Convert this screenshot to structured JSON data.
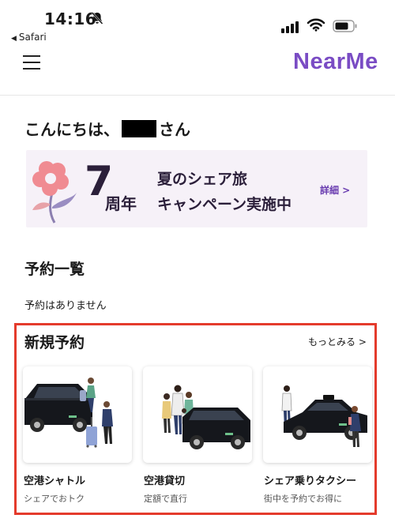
{
  "status_bar": {
    "time": "14:16",
    "back_app": "Safari"
  },
  "app_bar": {
    "logo": "NearMe"
  },
  "greeting": {
    "prefix": "こんにちは、",
    "suffix": "さん"
  },
  "banner": {
    "number": "7",
    "unit": "周年",
    "line1": "夏のシェア旅",
    "line2": "キャンペーン実施中",
    "detail_label": "詳細 >"
  },
  "reservations": {
    "title": "予約一覧",
    "empty_message": "予約はありません"
  },
  "new_reservation": {
    "title": "新規予約",
    "more_label": "もっとみる >",
    "cards": [
      {
        "title": "空港シャトル",
        "subtitle": "シェアでおトク"
      },
      {
        "title": "空港貸切",
        "subtitle": "定額で直行"
      },
      {
        "title": "シェア乗りタクシー",
        "subtitle": "街中を予約でお得に"
      }
    ]
  },
  "colors": {
    "brand": "#7a4cc4",
    "highlight_border": "#e43b2c",
    "banner_bg": "#f6f1f8"
  }
}
